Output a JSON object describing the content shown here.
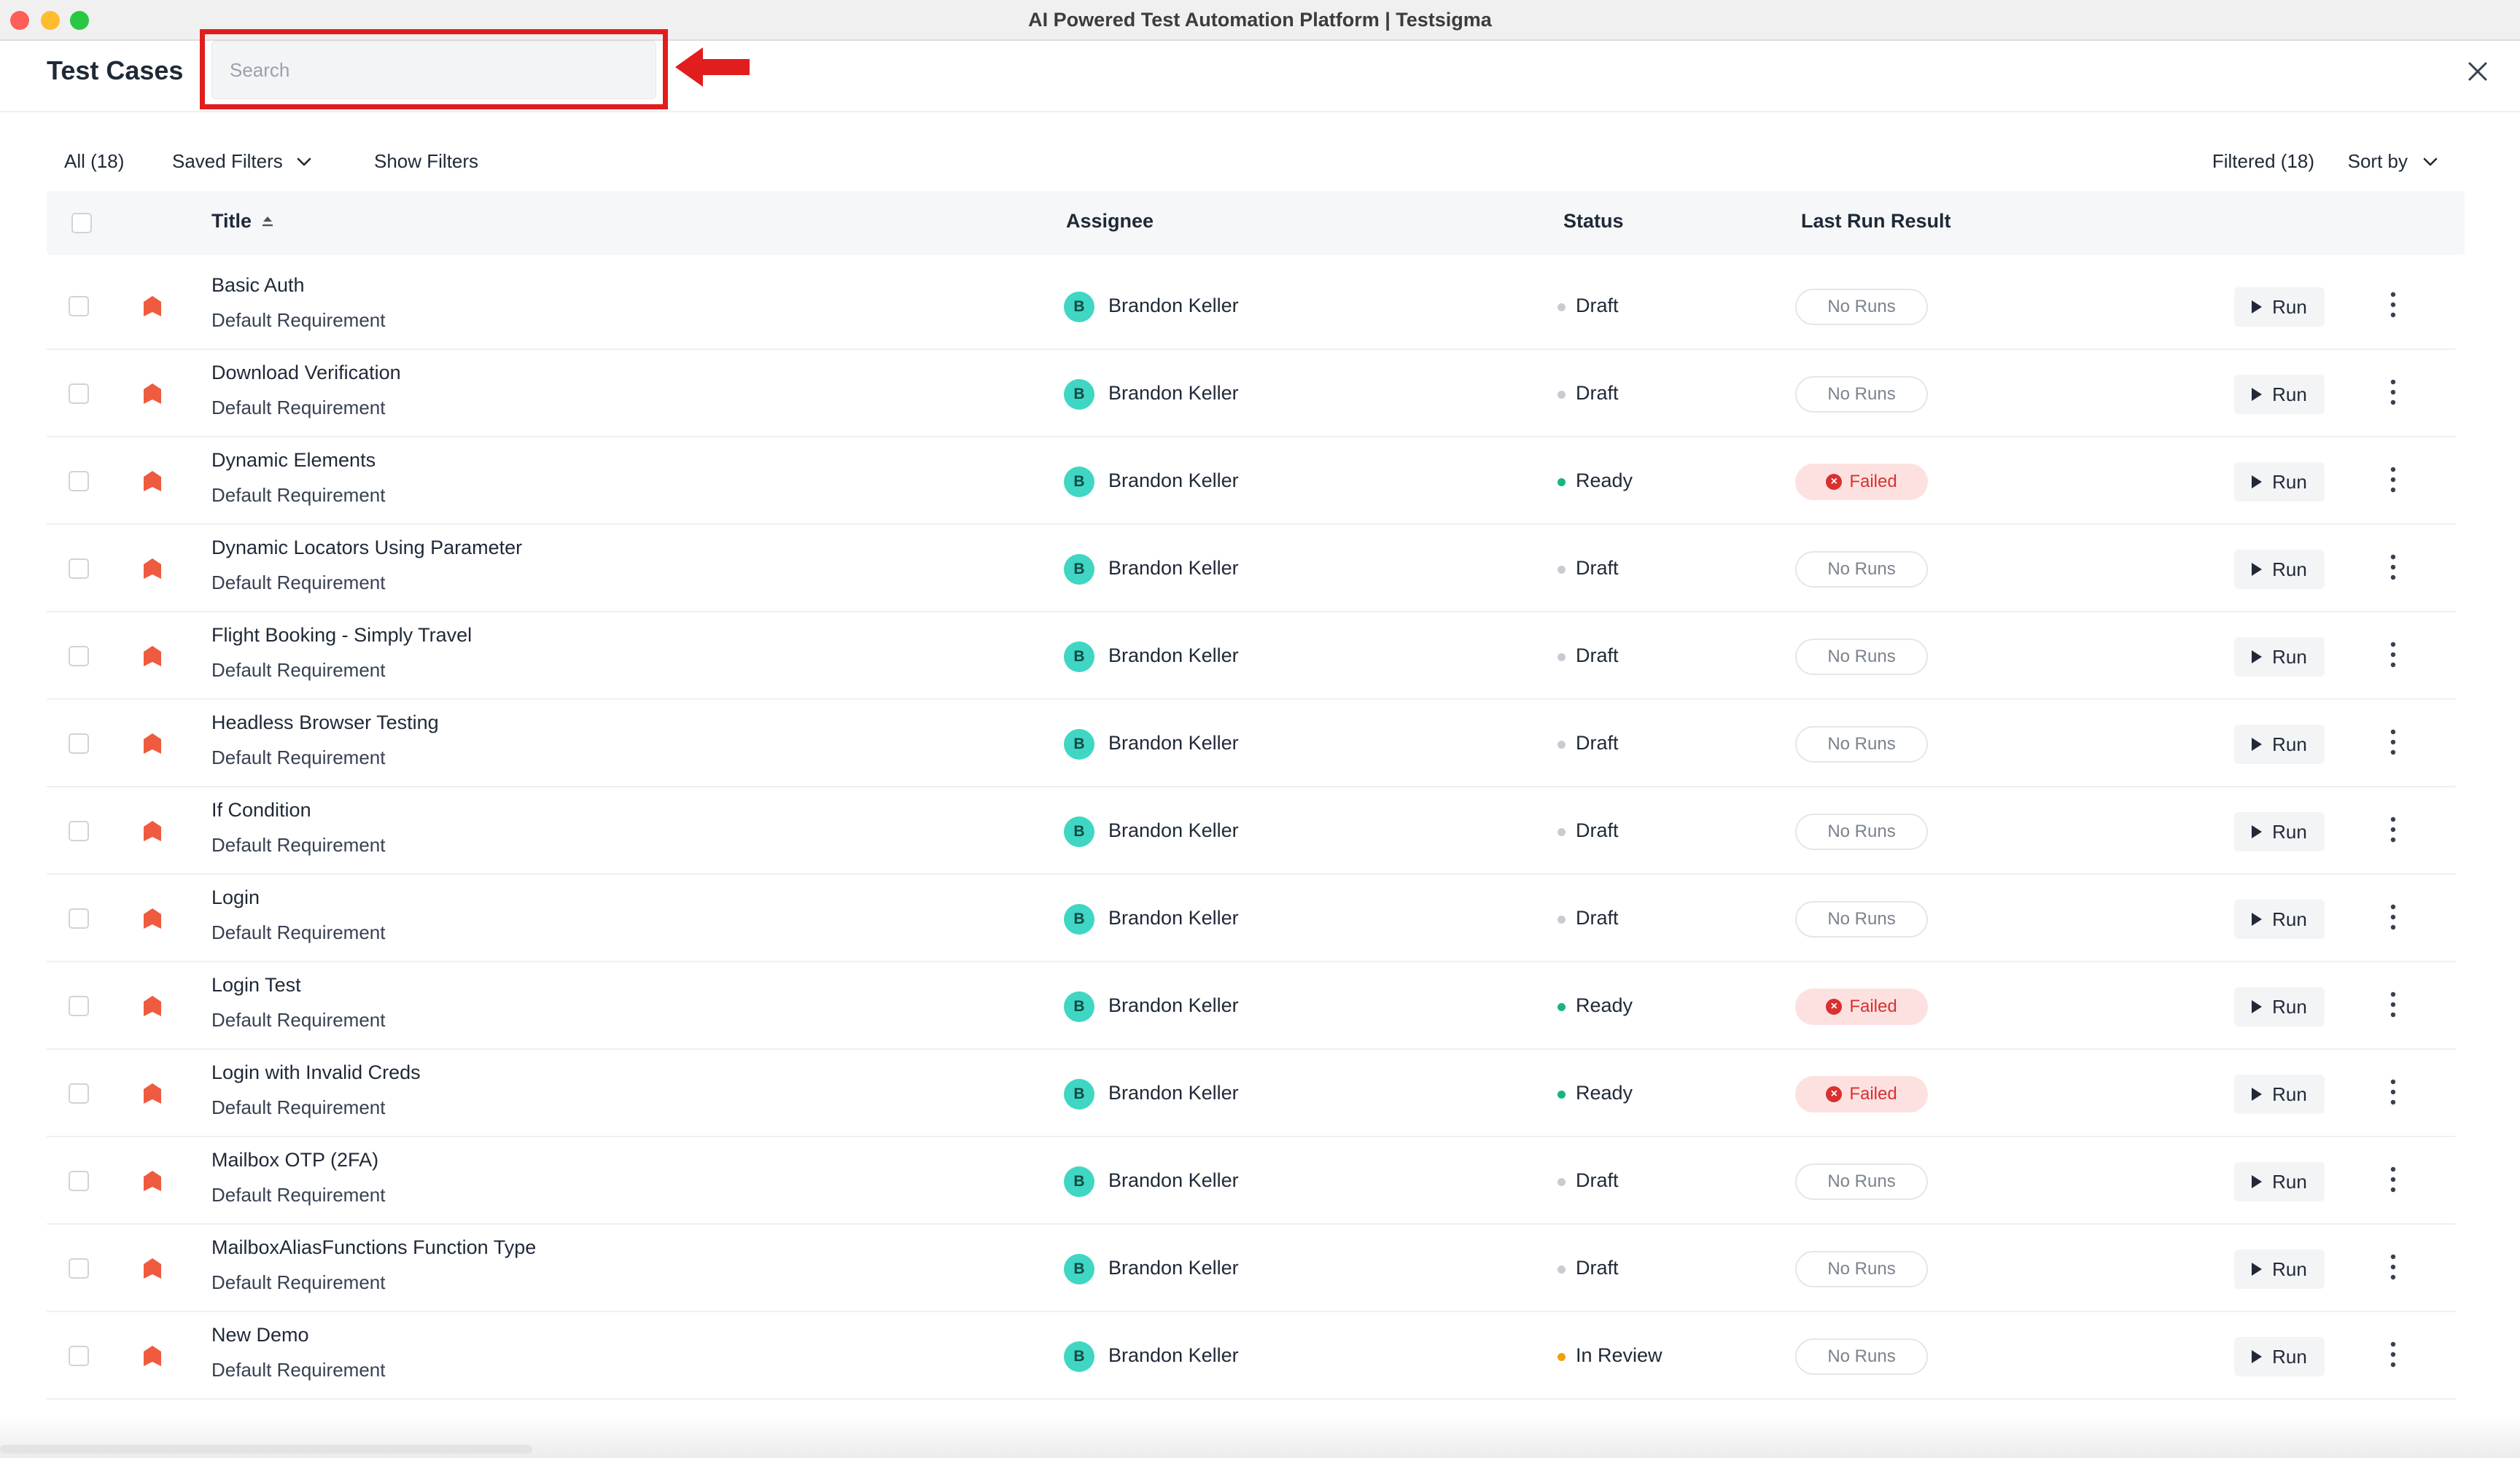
{
  "window": {
    "title": "AI Powered Test Automation Platform | Testsigma"
  },
  "header": {
    "title": "Test Cases",
    "search_placeholder": "Search"
  },
  "toolbar": {
    "all_label": "All (18)",
    "saved_filters_label": "Saved Filters",
    "show_filters_label": "Show Filters",
    "filtered_label": "Filtered (18)",
    "sort_by_label": "Sort by"
  },
  "table": {
    "columns": {
      "title": "Title",
      "assignee": "Assignee",
      "status": "Status",
      "last_run_result": "Last Run Result"
    },
    "rows": [
      {
        "title": "Basic Auth",
        "requirement": "Default Requirement",
        "avatar_letter": "B",
        "assignee": "Brandon Keller",
        "status": "Draft",
        "status_kind": "draft",
        "result": "No Runs",
        "result_kind": "none",
        "run_label": "Run"
      },
      {
        "title": "Download Verification",
        "requirement": "Default Requirement",
        "avatar_letter": "B",
        "assignee": "Brandon Keller",
        "status": "Draft",
        "status_kind": "draft",
        "result": "No Runs",
        "result_kind": "none",
        "run_label": "Run"
      },
      {
        "title": "Dynamic Elements",
        "requirement": "Default Requirement",
        "avatar_letter": "B",
        "assignee": "Brandon Keller",
        "status": "Ready",
        "status_kind": "ready",
        "result": "Failed",
        "result_kind": "failed",
        "run_label": "Run"
      },
      {
        "title": "Dynamic Locators Using Parameter",
        "requirement": "Default Requirement",
        "avatar_letter": "B",
        "assignee": "Brandon Keller",
        "status": "Draft",
        "status_kind": "draft",
        "result": "No Runs",
        "result_kind": "none",
        "run_label": "Run"
      },
      {
        "title": "Flight Booking - Simply Travel",
        "requirement": "Default Requirement",
        "avatar_letter": "B",
        "assignee": "Brandon Keller",
        "status": "Draft",
        "status_kind": "draft",
        "result": "No Runs",
        "result_kind": "none",
        "run_label": "Run"
      },
      {
        "title": "Headless Browser Testing",
        "requirement": "Default Requirement",
        "avatar_letter": "B",
        "assignee": "Brandon Keller",
        "status": "Draft",
        "status_kind": "draft",
        "result": "No Runs",
        "result_kind": "none",
        "run_label": "Run"
      },
      {
        "title": "If Condition",
        "requirement": "Default Requirement",
        "avatar_letter": "B",
        "assignee": "Brandon Keller",
        "status": "Draft",
        "status_kind": "draft",
        "result": "No Runs",
        "result_kind": "none",
        "run_label": "Run"
      },
      {
        "title": "Login",
        "requirement": "Default Requirement",
        "avatar_letter": "B",
        "assignee": "Brandon Keller",
        "status": "Draft",
        "status_kind": "draft",
        "result": "No Runs",
        "result_kind": "none",
        "run_label": "Run"
      },
      {
        "title": "Login Test",
        "requirement": "Default Requirement",
        "avatar_letter": "B",
        "assignee": "Brandon Keller",
        "status": "Ready",
        "status_kind": "ready",
        "result": "Failed",
        "result_kind": "failed",
        "run_label": "Run"
      },
      {
        "title": "Login with Invalid Creds",
        "requirement": "Default Requirement",
        "avatar_letter": "B",
        "assignee": "Brandon Keller",
        "status": "Ready",
        "status_kind": "ready",
        "result": "Failed",
        "result_kind": "failed",
        "run_label": "Run"
      },
      {
        "title": "Mailbox OTP (2FA)",
        "requirement": "Default Requirement",
        "avatar_letter": "B",
        "assignee": "Brandon Keller",
        "status": "Draft",
        "status_kind": "draft",
        "result": "No Runs",
        "result_kind": "none",
        "run_label": "Run"
      },
      {
        "title": "MailboxAliasFunctions Function Type",
        "requirement": "Default Requirement",
        "avatar_letter": "B",
        "assignee": "Brandon Keller",
        "status": "Draft",
        "status_kind": "draft",
        "result": "No Runs",
        "result_kind": "none",
        "run_label": "Run"
      },
      {
        "title": "New Demo",
        "requirement": "Default Requirement",
        "avatar_letter": "B",
        "assignee": "Brandon Keller",
        "status": "In Review",
        "status_kind": "review",
        "result": "No Runs",
        "result_kind": "none",
        "run_label": "Run"
      }
    ]
  },
  "icons": {
    "priority": "priority-flag-icon",
    "row_menu": "more-vertical-icon",
    "run": "play-icon",
    "close": "close-icon",
    "sort": "sort-ascending-icon",
    "chevron": "chevron-down-icon",
    "annotation": "arrow-left-icon"
  },
  "colors": {
    "annotation_red": "#e11d1d",
    "priority": "#ef5b3f",
    "avatar": "#3fd6c4",
    "ready": "#16b57e",
    "review": "#f59e0b",
    "draft": "#c7ccd3",
    "failed": "#d8312f"
  }
}
